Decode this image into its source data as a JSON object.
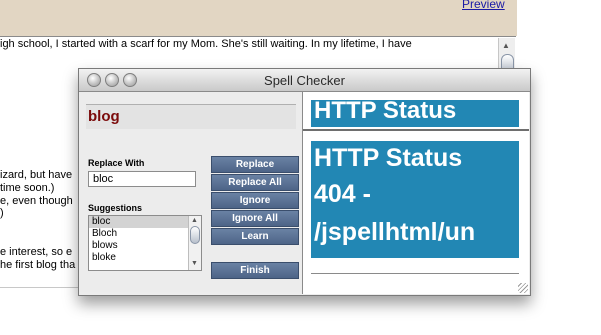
{
  "page": {
    "preview_link": "Preview",
    "editor_lines": [
      "igh school, I started with a scarf for my Mom.  She's still waiting.  In my lifetime, I have",
      "izard, but have",
      "time soon.)",
      "e, even though",
      ")",
      "e interest, so e",
      "he first blog tha"
    ]
  },
  "dialog": {
    "title": "Spell Checker",
    "misspelled_word": "blog",
    "replace_with_label": "Replace With",
    "replace_value": "bloc",
    "suggestions_label": "Suggestions",
    "suggestions": [
      "bloc",
      "Bloch",
      "blows",
      "bloke"
    ],
    "selected_suggestion": "bloc",
    "buttons": {
      "replace": "Replace",
      "replace_all": "Replace All",
      "ignore": "Ignore",
      "ignore_all": "Ignore All",
      "learn": "Learn",
      "finish": "Finish"
    }
  },
  "preview": {
    "frame1_text": "HTTP Status",
    "frame2_lines": [
      "HTTP Status",
      "404 -",
      "/jspellhtml/un"
    ]
  },
  "colors": {
    "title_word": "#7b0a0a",
    "button_blue": "#5a7297",
    "error_page_blue": "#2287b4",
    "header_tan": "#e2d6c3"
  }
}
